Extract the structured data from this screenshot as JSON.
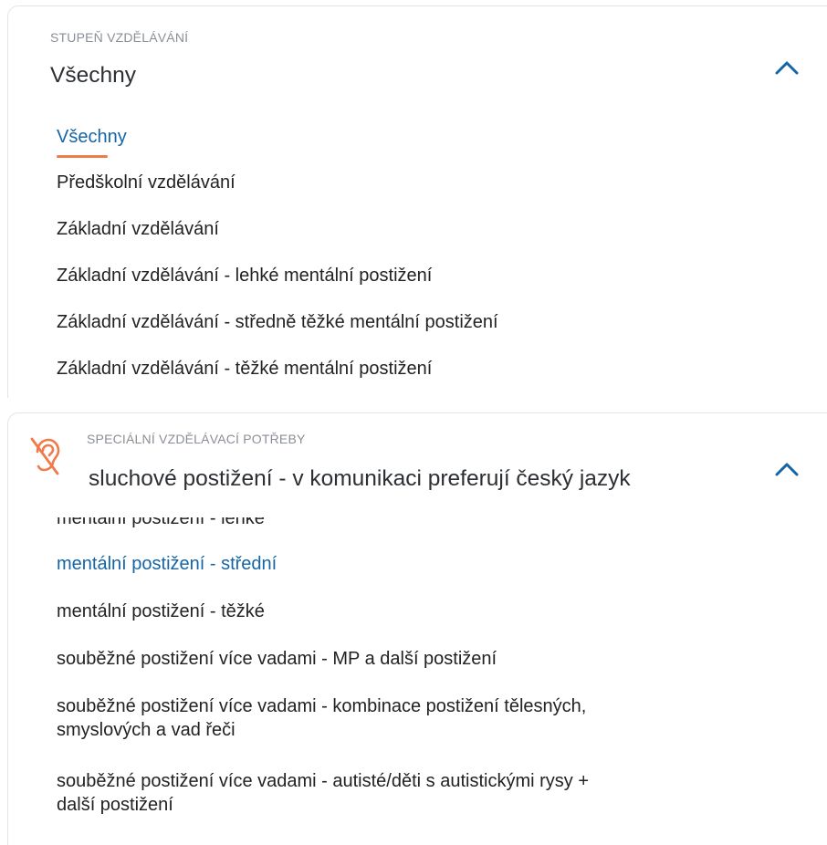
{
  "education_level": {
    "label": "STUPEŇ VZDĚLÁVÁNÍ",
    "value": "Všechny",
    "options": [
      "Všechny",
      "Předškolní vzdělávání",
      "Základní vzdělávání",
      "Základní vzdělávání - lehké mentální postižení",
      "Základní vzdělávání - středně těžké mentální postižení",
      "Základní vzdělávání - těžké mentální postižení"
    ]
  },
  "special_needs": {
    "label": "SPECIÁLNÍ VZDĚLÁVACÍ POTŘEBY",
    "value": "sluchové postižení - v komunikaci preferují český jazyk",
    "options": [
      "mentální postižení - lehké",
      "mentální postižení - střední",
      "mentální postižení - těžké",
      "souběžné postižení více vadami - MP a další postižení",
      "souběžné postižení více vadami - kombinace postižení tělesných,",
      "smyslových a vad řeči",
      "souběžné postižení více vadami - autisté/děti s autistickými rysy +",
      "další postižení"
    ]
  },
  "colors": {
    "accent": "#f07b4a",
    "selected": "#1565a6",
    "chevron": "#1565a6"
  },
  "icons": [
    "chevron-up-icon",
    "hearing-disabled-icon"
  ]
}
